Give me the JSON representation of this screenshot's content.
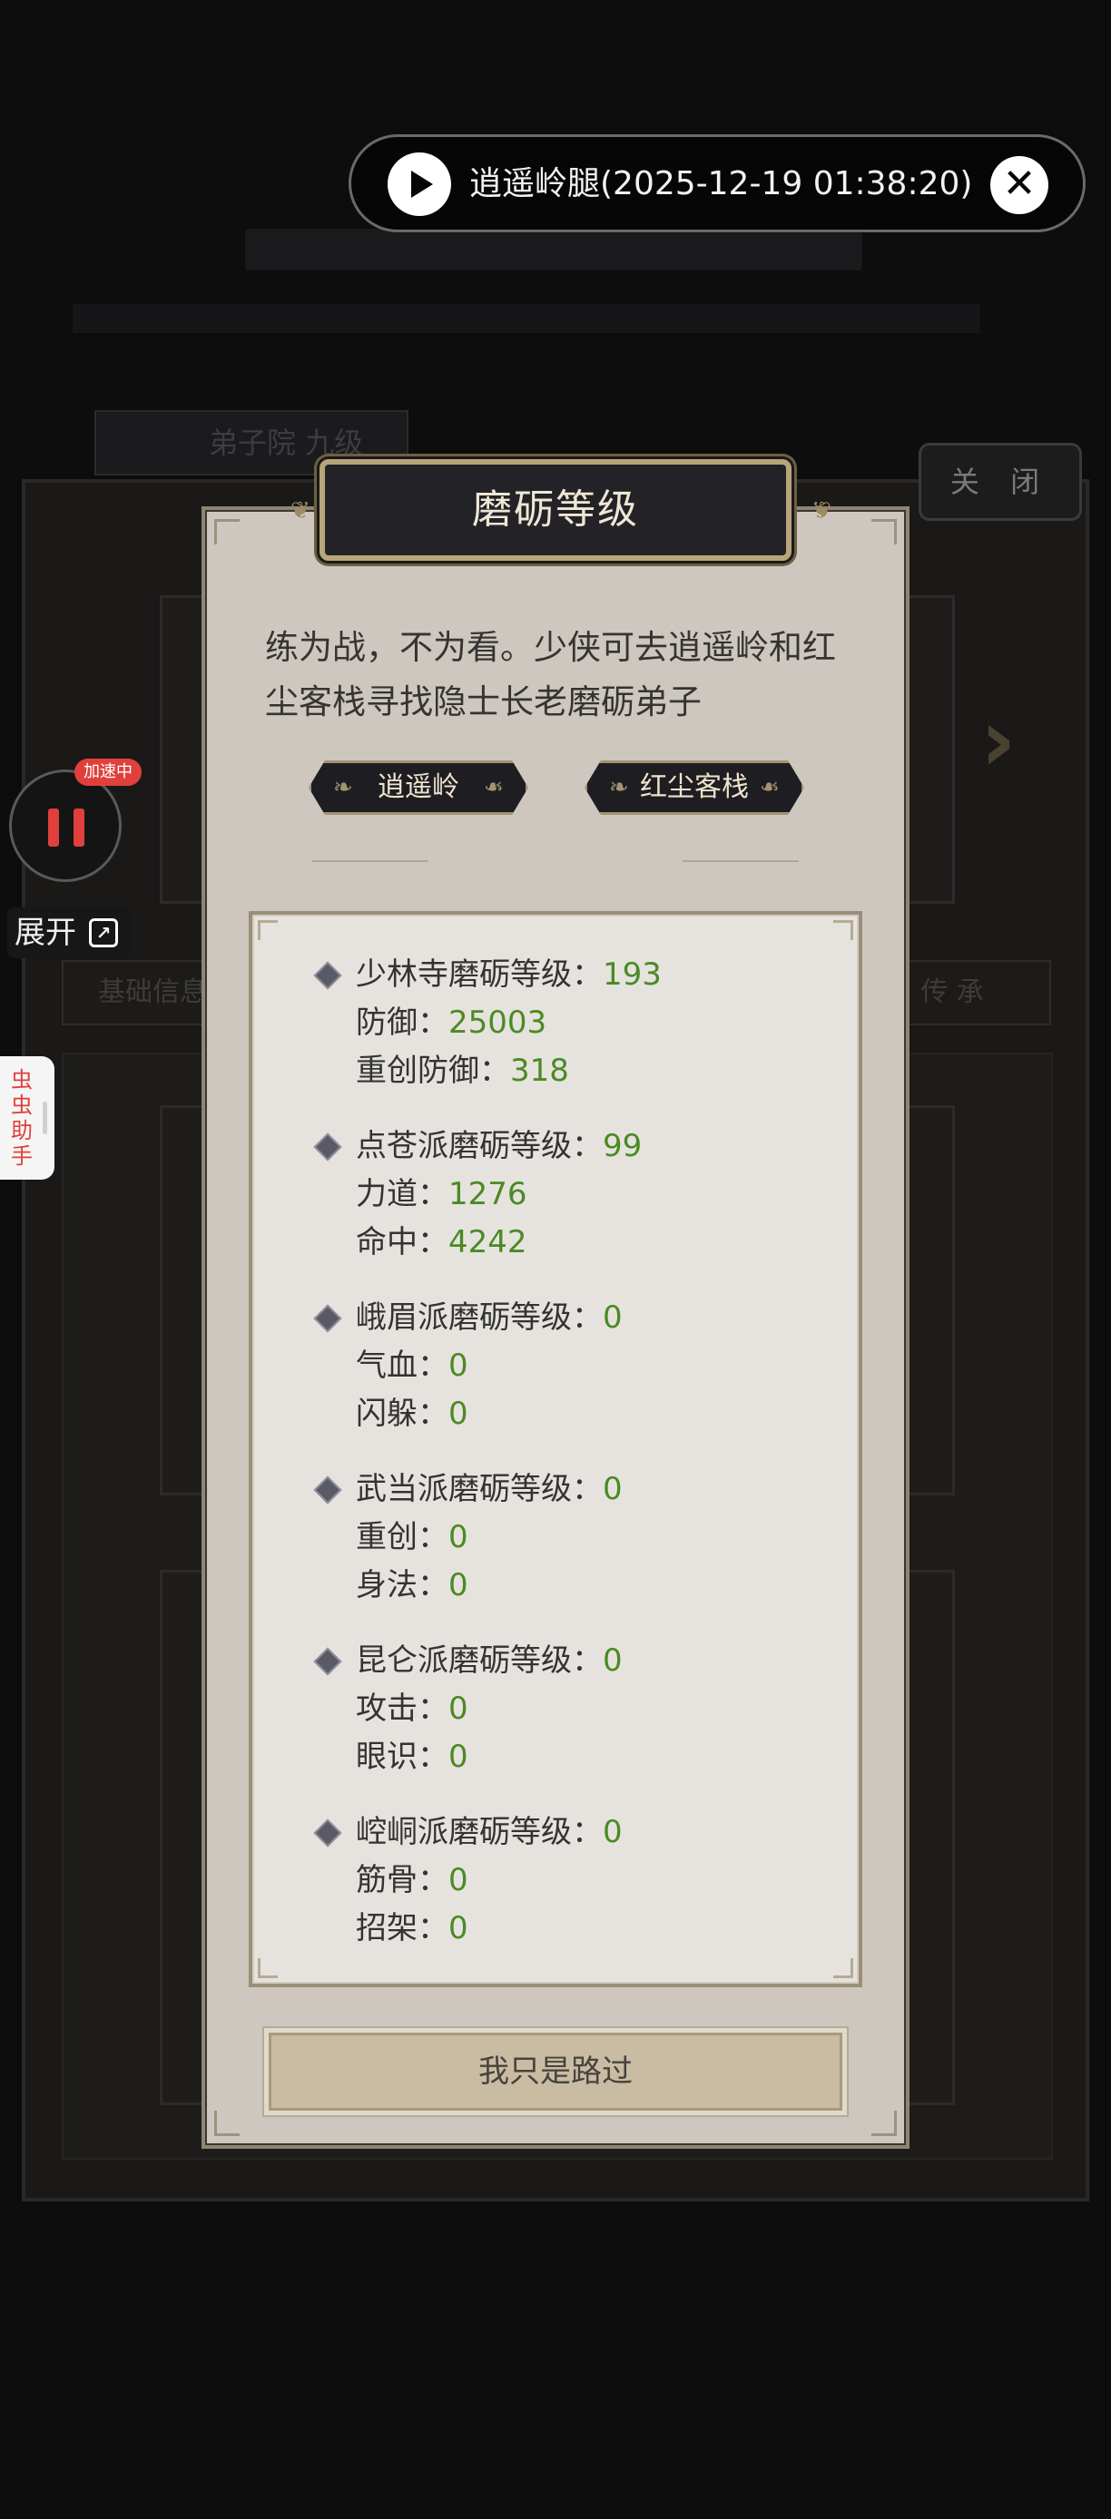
{
  "background": {
    "tab_label": "弟子院 九级",
    "ribbon_left": "基础信息",
    "ribbon_right": "传 承",
    "close_label": "关 闭"
  },
  "overlay": {
    "video_title": "逍遥岭腿(2025-12-19 01:38:20)",
    "speed_badge": "加速中",
    "expand_label": "展开",
    "helper_label": "虫虫助手"
  },
  "dialog": {
    "title": "磨砺等级",
    "description": "练为战，不为看。少侠可去逍遥岭和红尘客栈寻找隐士长老磨砺弟子",
    "locations": [
      {
        "label": "逍遥岭"
      },
      {
        "label": "红尘客栈"
      }
    ],
    "groups": [
      {
        "sect": "少林寺磨砺等级：",
        "level": "193",
        "stats": [
          {
            "name": "防御：",
            "value": "25003"
          },
          {
            "name": "重创防御：",
            "value": "318"
          }
        ]
      },
      {
        "sect": "点苍派磨砺等级：",
        "level": "99",
        "stats": [
          {
            "name": "力道：",
            "value": "1276"
          },
          {
            "name": "命中：",
            "value": "4242"
          }
        ]
      },
      {
        "sect": "峨眉派磨砺等级：",
        "level": "0",
        "stats": [
          {
            "name": "气血：",
            "value": "0"
          },
          {
            "name": "闪躲：",
            "value": "0"
          }
        ]
      },
      {
        "sect": "武当派磨砺等级：",
        "level": "0",
        "stats": [
          {
            "name": "重创：",
            "value": "0"
          },
          {
            "name": "身法：",
            "value": "0"
          }
        ]
      },
      {
        "sect": "昆仑派磨砺等级：",
        "level": "0",
        "stats": [
          {
            "name": "攻击：",
            "value": "0"
          },
          {
            "name": "眼识：",
            "value": "0"
          }
        ]
      },
      {
        "sect": "崆峒派磨砺等级：",
        "level": "0",
        "stats": [
          {
            "name": "筋骨：",
            "value": "0"
          },
          {
            "name": "招架：",
            "value": "0"
          }
        ]
      }
    ],
    "pass_button": "我只是路过"
  },
  "colors": {
    "value_green": "#4b8a24",
    "dialog_bg": "#cdc7bf",
    "title_plate": "#232327",
    "accent_gold": "#b9a57a",
    "badge_red": "#e0403c"
  }
}
